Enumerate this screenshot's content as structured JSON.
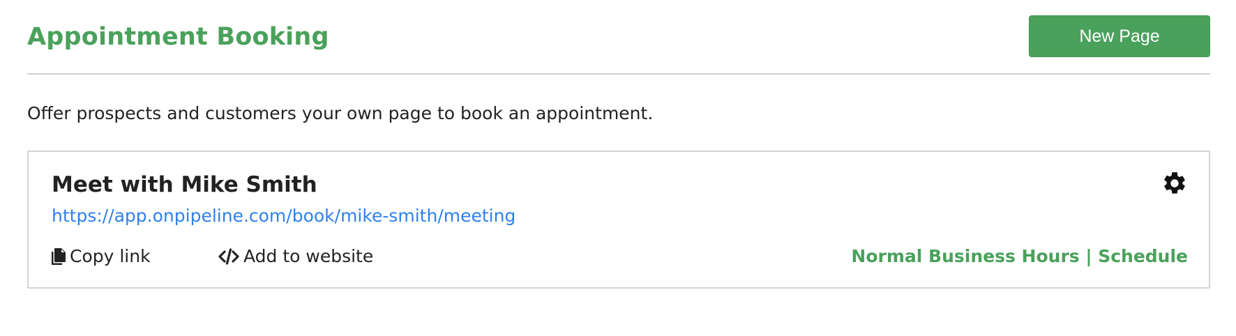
{
  "header": {
    "title": "Appointment Booking",
    "new_page_label": "New Page"
  },
  "description": "Offer prospects and customers your own page to book an appointment.",
  "booking_pages": [
    {
      "title": "Meet with Mike Smith",
      "url": "https://app.onpipeline.com/book/mike-smith/meeting",
      "copy_link_label": "Copy link",
      "add_to_website_label": "Add to website",
      "schedule_label": "Normal Business Hours | Schedule",
      "icons": {
        "settings": "gear-icon",
        "copy": "copy-icon",
        "embed": "code-icon"
      }
    }
  ],
  "colors": {
    "accent": "#4aa15b",
    "link": "#2f80ed",
    "text": "#222222",
    "border": "#d4d4d4"
  }
}
